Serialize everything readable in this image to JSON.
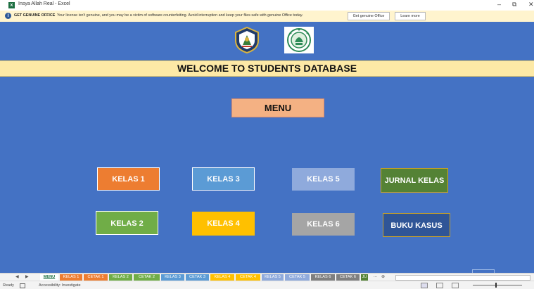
{
  "window": {
    "title": "Insya Allah Real - Excel",
    "minimize_glyph": "–",
    "restore_glyph": "⧉",
    "close_glyph": "✕"
  },
  "warning": {
    "title": "GET GENUINE OFFICE",
    "message": "Your license isn't genuine, and you may be a victim of software counterfeiting. Avoid interruption and keep your files safe with genuine Office today.",
    "get_genuine_label": "Get genuine Office",
    "learn_more_label": "Learn more"
  },
  "sheet": {
    "background": "#4472c4",
    "banner_title": "WELCOME TO STUDENTS DATABASE",
    "banner_color": "#fde9a6",
    "menu_label": "MENU",
    "buttons": [
      {
        "label": "KELAS 1",
        "color": "#ed7d31"
      },
      {
        "label": "KELAS 3",
        "color": "#5b9bd5"
      },
      {
        "label": "KELAS 5",
        "color": "#8faadc"
      },
      {
        "label": "JURNAL KELAS",
        "color": "#548235"
      },
      {
        "label": "KELAS 2",
        "color": "#70ad47"
      },
      {
        "label": "KELAS 4",
        "color": "#ffc000"
      },
      {
        "label": "KELAS 6",
        "color": "#a5a5a5"
      },
      {
        "label": "BUKU KASUS",
        "color": "#2f5597"
      }
    ]
  },
  "tabs": [
    {
      "label": "MENU",
      "color": "#ffffff",
      "active": true
    },
    {
      "label": "KELAS 1",
      "color": "#ed7d31"
    },
    {
      "label": "CETAK 1",
      "color": "#ed7d31"
    },
    {
      "label": "KELAS 2",
      "color": "#70ad47"
    },
    {
      "label": "CETAK 2",
      "color": "#70ad47"
    },
    {
      "label": "KELAS 3",
      "color": "#5b9bd5"
    },
    {
      "label": "CETAK 3",
      "color": "#5b9bd5"
    },
    {
      "label": "KELAS 4",
      "color": "#ffc000"
    },
    {
      "label": "CETAK 4",
      "color": "#ffc000"
    },
    {
      "label": "KELAS 5",
      "color": "#8faadc"
    },
    {
      "label": "CETAK 5",
      "color": "#8faadc"
    },
    {
      "label": "KELAS 6",
      "color": "#7f7f7f"
    },
    {
      "label": "CETAK 6",
      "color": "#7f7f7f"
    },
    {
      "label": "JU",
      "color": "#548235"
    }
  ],
  "tab_nav": {
    "prev": "◀",
    "next": "▶",
    "more": "...",
    "add": "⊕"
  },
  "status": {
    "ready": "Ready",
    "accessibility": "Accessibility: Investigate"
  }
}
